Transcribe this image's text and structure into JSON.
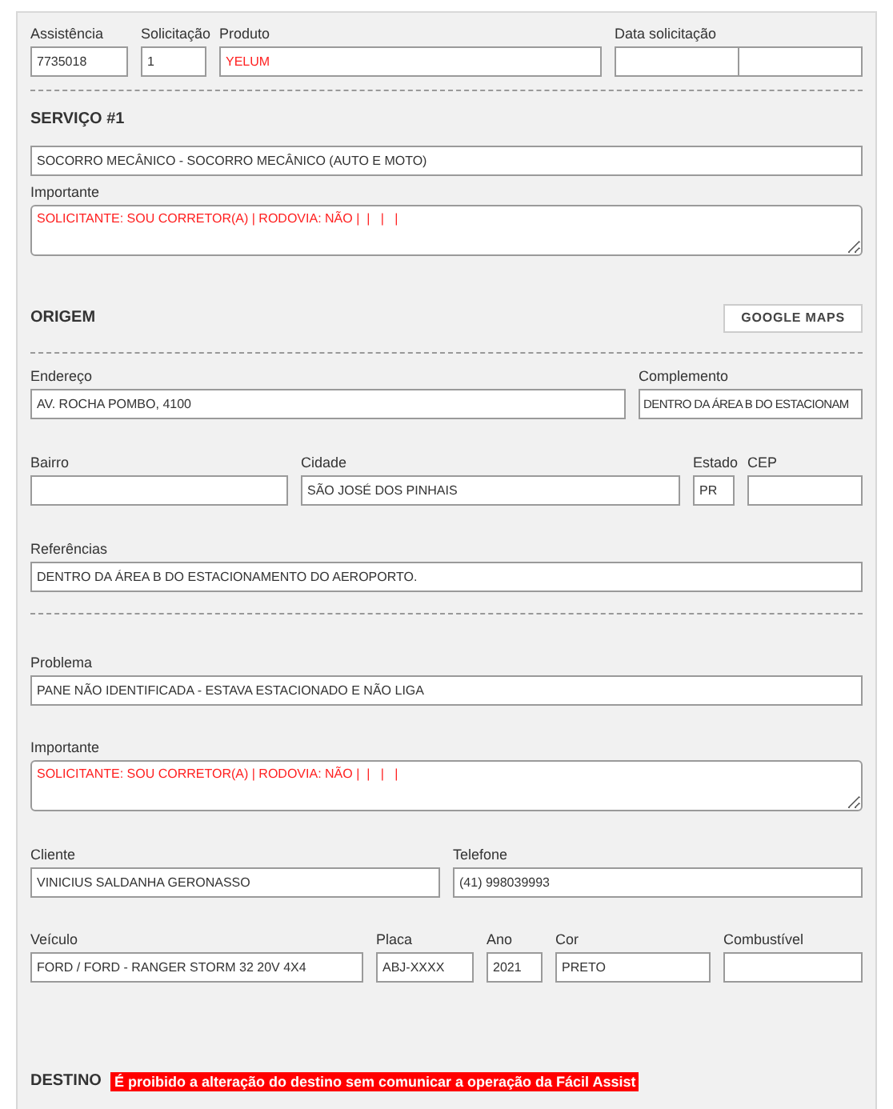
{
  "header_fields": [
    {
      "kind": "text",
      "label": "Assistência",
      "value": "7735018"
    },
    {
      "kind": "text",
      "label": "Solicitação",
      "value": "1"
    },
    {
      "kind": "text",
      "label": "Produto",
      "value": "YELUM",
      "highlight": true
    },
    {
      "kind": "split",
      "label": "Data solicitação"
    }
  ],
  "service": {
    "title": "SERVIÇO #1",
    "value": "SOCORRO MECÂNICO - SOCORRO MECÂNICO (AUTO E MOTO)",
    "important": {
      "label": "Importante",
      "value": "SOLICITANTE: SOU CORRETOR(A) | RODOVIA: NÃO |  |   |   |",
      "highlight": true
    }
  },
  "origin": {
    "title": "ORIGEM",
    "button": "GOOGLE MAPS",
    "address_row": [
      {
        "label": "Endereço",
        "value": "AV. ROCHA POMBO, 4100"
      },
      {
        "label": "Complemento",
        "value": "DENTRO DA ÁREA B DO ESTACIONAM"
      }
    ],
    "city_row": [
      {
        "label": "Bairro"
      },
      {
        "label": "Cidade",
        "value": "SÃO JOSÉ DOS PINHAIS"
      },
      {
        "label": "Estado",
        "value": "PR"
      },
      {
        "label": "CEP"
      }
    ],
    "reference": {
      "label": "Referências",
      "value": "DENTRO DA ÁREA B DO ESTACIONAMENTO DO AEROPORTO."
    }
  },
  "problem": {
    "label": "Problema",
    "value": "PANE NÃO IDENTIFICADA - ESTAVA ESTACIONADO E NÃO LIGA"
  },
  "important": {
    "label": "Importante",
    "value": "SOLICITANTE: SOU CORRETOR(A) | RODOVIA: NÃO |  |   |   |",
    "highlight": true
  },
  "client_row": [
    {
      "label": "Cliente",
      "value": "VINICIUS SALDANHA GERONASSO"
    },
    {
      "label": "Telefone",
      "value": "(41) 998039993"
    }
  ],
  "vehicle_row": [
    {
      "label": "Veículo",
      "value": "FORD / FORD - RANGER STORM 32 20V 4X4"
    },
    {
      "label": "Placa",
      "value": "ABJ-XXXX"
    },
    {
      "label": "Ano",
      "value": "2021"
    },
    {
      "label": "Cor",
      "value": "PRETO"
    },
    {
      "label": "Combustível"
    }
  ],
  "destination": {
    "title": "DESTINO",
    "warning": "É proibido a alteração do destino sem comunicar a operação da Fácil Assist"
  }
}
